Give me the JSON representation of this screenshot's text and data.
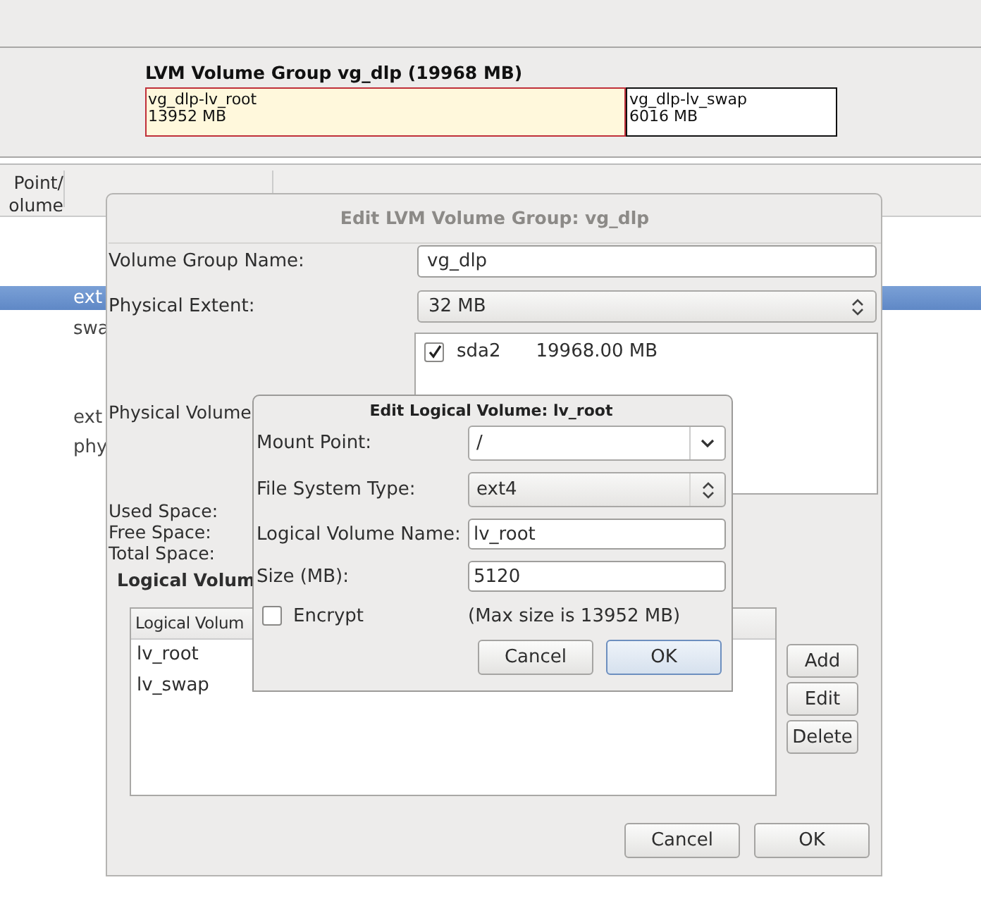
{
  "volume_group": {
    "title": "LVM Volume Group vg_dlp (19968 MB)",
    "segments": [
      {
        "name": "vg_dlp-lv_root",
        "size": "13952 MB",
        "selected": true
      },
      {
        "name": "vg_dlp-lv_swap",
        "size": "6016 MB",
        "selected": false
      }
    ]
  },
  "device_table": {
    "header_lines": [
      "Point/",
      "olume"
    ],
    "rows": [
      {
        "text": "ext",
        "selected": true
      },
      {
        "text": "swa",
        "selected": false
      },
      {
        "text": "ext",
        "selected": false
      },
      {
        "text": "phy",
        "selected": false
      }
    ]
  },
  "group_dialog": {
    "title": "Edit LVM Volume Group: vg_dlp",
    "name_label": "Volume Group Name:",
    "name_value": "vg_dlp",
    "extent_label": "Physical Extent:",
    "extent_value": "32 MB",
    "pv_label": "Physical Volume",
    "physical_volumes": [
      {
        "device": "sda2",
        "size": "19968.00 MB",
        "checked": true
      }
    ],
    "space_labels": [
      "Used Space:",
      "Free Space:",
      "Total Space:"
    ],
    "lv_heading": "Logical Volum",
    "lv_table": {
      "header": "Logical Volum",
      "rows": [
        "lv_root",
        "lv_swap"
      ]
    },
    "side_buttons": [
      "Add",
      "Edit",
      "Delete"
    ],
    "buttons": [
      {
        "label": "Cancel",
        "default": false
      },
      {
        "label": "OK",
        "default": false
      }
    ]
  },
  "volume_dialog": {
    "title": "Edit Logical Volume: lv_root",
    "mount_label": "Mount Point:",
    "mount_value": "/",
    "fs_label": "File System Type:",
    "fs_value": "ext4",
    "name_label": "Logical Volume Name:",
    "name_value": "lv_root",
    "size_label": "Size (MB):",
    "size_value": "5120",
    "encrypt": {
      "label": "Encrypt",
      "checked": false
    },
    "max_size": "(Max size is 13952 MB)",
    "buttons": [
      {
        "label": "Cancel",
        "default": false
      },
      {
        "label": "OK",
        "default": true
      }
    ]
  }
}
